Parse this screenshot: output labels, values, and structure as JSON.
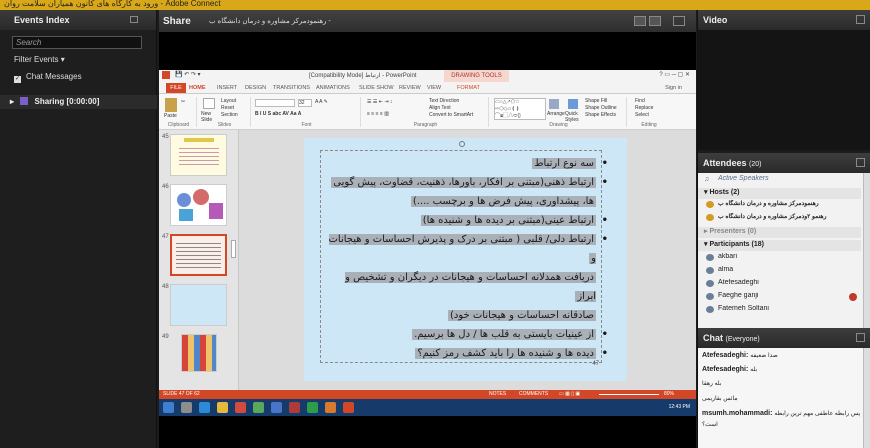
{
  "window": {
    "title": "ورود به کارگاه های کانون همیاران سلامت روان - Adobe Connect",
    "accent": "#d8a818"
  },
  "events": {
    "title": "Events Index",
    "search_placeholder": "Search",
    "filter_label": "Filter Events",
    "chat_messages_label": "Chat Messages",
    "sharing_label": "Sharing [0:00:00]"
  },
  "share": {
    "title": "Share",
    "doc_name": "رهنمودمرکز مشاوره و درمان دانشگاه ب -"
  },
  "ppt": {
    "title_bar": "[Compatibility Mode] ارتباط - PowerPoint",
    "drawing_tools": "DRAWING TOOLS",
    "signin": "Sign in",
    "tabs": [
      "FILE",
      "HOME",
      "INSERT",
      "DESIGN",
      "TRANSITIONS",
      "ANIMATIONS",
      "SLIDE SHOW",
      "REVIEW",
      "VIEW",
      "FORMAT"
    ],
    "groups": [
      "Clipboard",
      "Slides",
      "Font",
      "Paragraph",
      "Drawing",
      "Editing"
    ],
    "ribbon": {
      "paste": "Paste",
      "new_slide": "New Slide",
      "layout": "Layout",
      "reset": "Reset",
      "section": "Section",
      "font_size": "32",
      "text_direction": "Text Direction",
      "align_text": "Align Text",
      "smartart": "Convert to SmartArt",
      "arrange": "Arrange",
      "quick_styles": "Quick Styles",
      "shape_fill": "Shape Fill",
      "shape_outline": "Shape Outline",
      "shape_effects": "Shape Effects",
      "find": "Find",
      "replace": "Replace",
      "select": "Select"
    },
    "thumbnails": [
      "45",
      "46",
      "47",
      "48",
      "49"
    ],
    "selected_thumbnail": "47",
    "slide_number": "47",
    "slide_lines": [
      "سه نوع ارتباط",
      "ارتباط ذهنی(مبتنی بر افکار، باورها، ذهنیت، قضاوت، پیش گویی",
      "ها، پیشداوری، پیش فرض ها و برچسب ....)",
      "ارتباط عینی(مبتنی بر دیده ها و شنیده ها)",
      "ارتباط دلی/ قلبی ( مبتنی بر درک و پذیرش احساسات و هیجانات و",
      "دریافت همدلانه احساسات و هیجانات در دیگران و تشخیص و ابراز",
      "صادقانه احساسات و هیجانات خود)",
      "از عینیات بایستی به قلب ها / دل ها برسیم.",
      "دیده ها و شنیده ها را باید کشف رمز کنیم؟"
    ],
    "status_left": "SLIDE 47 OF 62",
    "notes": "NOTES",
    "comments": "COMMENTS",
    "zoom": "80%",
    "clock": "12:43 PM"
  },
  "video": {
    "title": "Video"
  },
  "attendees": {
    "title": "Attendees",
    "count": "(20)",
    "active_speakers": "Active Speakers",
    "hosts_label": "Hosts (2)",
    "hosts": [
      "رهنمودمرکز مشاوره و درمان دانشگاه ب",
      "رهنمو ۲ودمرکز مشاوره و درمان دانشگاه ب"
    ],
    "presenters_label": "Presenters (0)",
    "participants_label": "Participants (18)",
    "participants": [
      "akbari",
      "alma",
      "Atefesadeghi",
      "Faeghe ganji",
      "Fatemeh Soltani"
    ]
  },
  "chat": {
    "title": "Chat",
    "scope": "(Everyone)",
    "messages": [
      {
        "from": "Atefesadeghi:",
        "text": "صدا ضعیفه"
      },
      {
        "from": "Atefesadeghi:",
        "text": "بله"
      },
      {
        "from": "",
        "text": "بله رهقا"
      },
      {
        "from": "",
        "text": "مائس بقاریمی"
      },
      {
        "from": "msumh.mohammadi:",
        "text": "پس رابطه عاطفی مهم ترین رابطه"
      },
      {
        "from": "",
        "text": "است؟"
      }
    ]
  }
}
